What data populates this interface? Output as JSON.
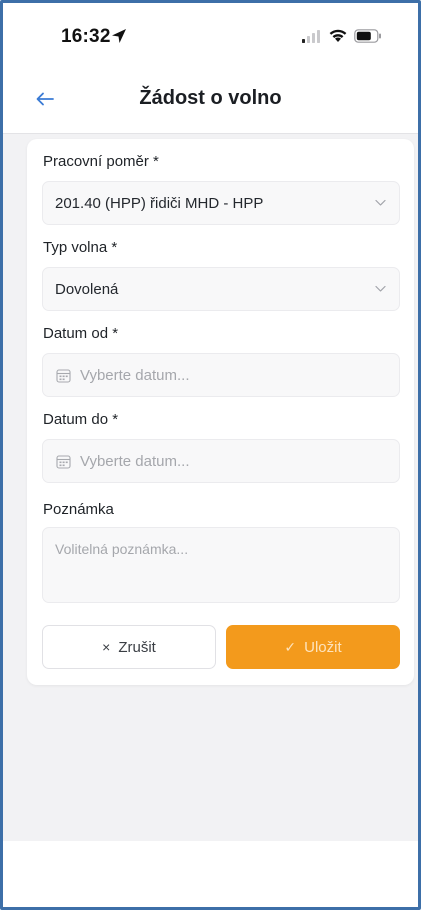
{
  "status_bar": {
    "time": "16:32"
  },
  "header": {
    "title": "Žádost o volno",
    "back_icon": "arrow-left-icon"
  },
  "form": {
    "employment": {
      "label": "Pracovní poměr *",
      "value": "201.40 (HPP) řidiči MHD - HPP"
    },
    "leave_type": {
      "label": "Typ volna *",
      "value": "Dovolená"
    },
    "date_from": {
      "label": "Datum od *",
      "placeholder": "Vyberte datum..."
    },
    "date_to": {
      "label": "Datum do *",
      "placeholder": "Vyberte datum..."
    },
    "note": {
      "label": "Poznámka",
      "placeholder": "Volitelná poznámka..."
    }
  },
  "actions": {
    "cancel_icon": "×",
    "cancel_label": "Zrušit",
    "save_icon": "✓",
    "save_label": "Uložit"
  },
  "colors": {
    "accent": "#f39a1c",
    "back_arrow": "#3a7bd5",
    "frame_border": "#3d6fa8"
  }
}
